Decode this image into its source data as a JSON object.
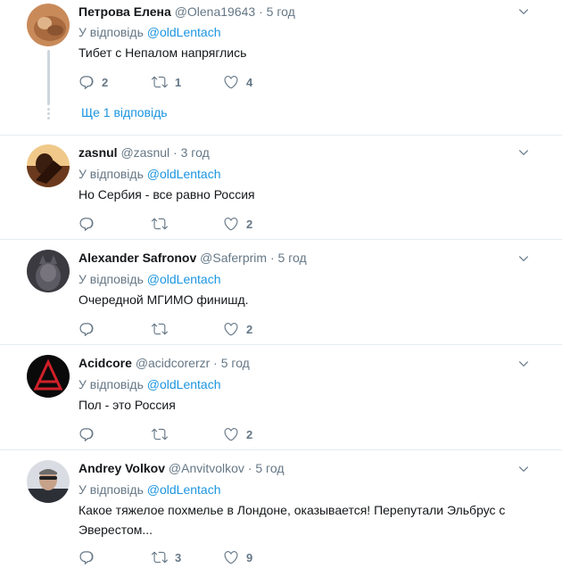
{
  "tweets": [
    {
      "name": "Петрова Елена",
      "handle": "@Olena19643",
      "separator": "·",
      "time": "5 год",
      "reply_prefix": "У відповідь",
      "reply_mention": "@oldLentach",
      "text": "Тибет с Непалом напряглись",
      "replies": "2",
      "retweets": "1",
      "likes": "4",
      "more_replies": "Ще 1 відповідь"
    },
    {
      "name": "zasnul",
      "handle": "@zasnul",
      "separator": "·",
      "time": "3 год",
      "reply_prefix": "У відповідь",
      "reply_mention": "@oldLentach",
      "text": "Но Сербия - все равно Россия",
      "replies": "",
      "retweets": "",
      "likes": "2"
    },
    {
      "name": "Alexander Safronov",
      "handle": "@Saferprim",
      "separator": "·",
      "time": "5 год",
      "reply_prefix": "У відповідь",
      "reply_mention": "@oldLentach",
      "text": "Очередной МГИМО финишд.",
      "replies": "",
      "retweets": "",
      "likes": "2"
    },
    {
      "name": "Acidcore",
      "handle": "@acidcorerzr",
      "separator": "·",
      "time": "5 год",
      "reply_prefix": "У відповідь",
      "reply_mention": "@oldLentach",
      "text": "Пол - это Россия",
      "replies": "",
      "retweets": "",
      "likes": "2"
    },
    {
      "name": "Andrey Volkov",
      "handle": "@Anvitvolkov",
      "separator": "·",
      "time": "5 год",
      "reply_prefix": "У відповідь",
      "reply_mention": "@oldLentach",
      "text_line1": "Какое тяжелое похмелье в Лондоне, оказывается! Перепутали Эльбрус с",
      "text_line2": "Эверестом...",
      "replies": "",
      "retweets": "3",
      "likes": "9"
    }
  ],
  "icons": {
    "reply": "reply-icon",
    "retweet": "retweet-icon",
    "like": "heart-icon",
    "menu": "chevron-down-icon"
  },
  "colors": {
    "link": "#1b95e0",
    "muted": "#657786",
    "text": "#14171a",
    "divider": "#e6ecf0"
  }
}
